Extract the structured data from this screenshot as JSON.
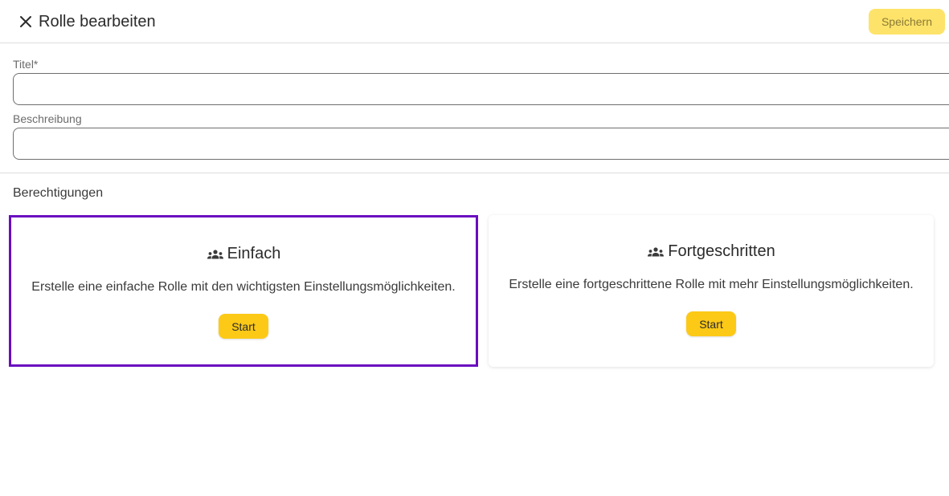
{
  "header": {
    "title": "Rolle bearbeiten",
    "close_icon": "close-icon",
    "save_label": "Speichern"
  },
  "form": {
    "title_label": "Titel*",
    "title_value": "",
    "description_label": "Beschreibung",
    "description_value": ""
  },
  "permissions": {
    "section_title": "Berechtigungen",
    "cards": [
      {
        "title": "Einfach",
        "icon": "group-icon",
        "description": "Erstelle eine einfache Rolle mit den wichtigsten Einstellungsmöglichkeiten.",
        "button_label": "Start",
        "selected": true
      },
      {
        "title": "Fortgeschritten",
        "icon": "group-icon",
        "description": "Erstelle eine fortgeschrittene Rolle mit mehr Einstellungsmöglichkeiten.",
        "button_label": "Start",
        "selected": false
      }
    ]
  },
  "colors": {
    "accent": "#fcc917",
    "save_disabled": "#fde36a",
    "selection_border": "#6a0dbf"
  }
}
